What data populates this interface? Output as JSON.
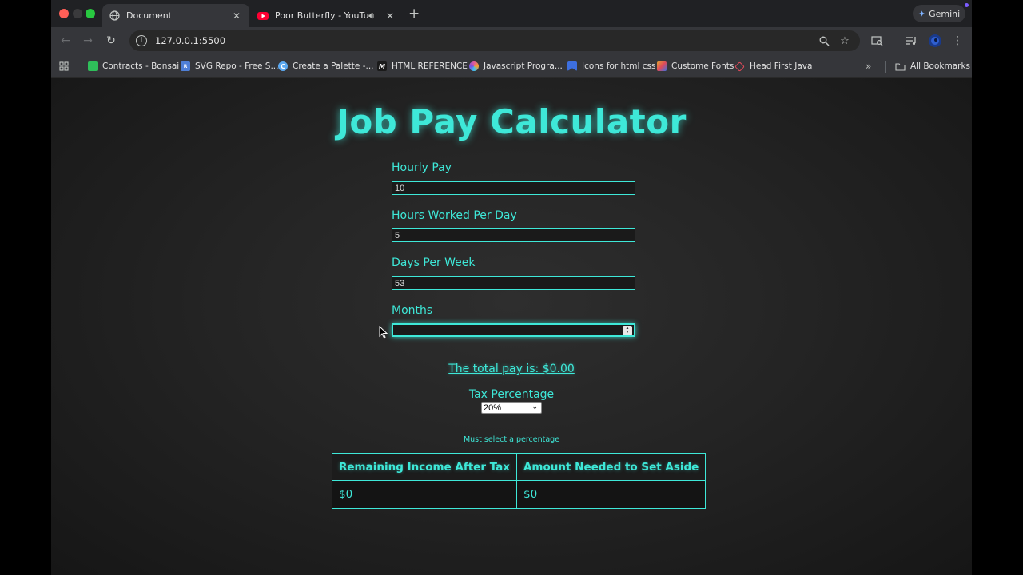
{
  "browser": {
    "tabs": [
      {
        "label": "Document",
        "active": true
      },
      {
        "label": "Poor Butterfly - YouTube",
        "active": false
      }
    ],
    "gemini_label": "Gemini",
    "url": "127.0.0.1:5500",
    "bookmarks": [
      {
        "label": "Contracts - Bonsai",
        "icon": "bonsai-icon",
        "color": "#2fbf5a"
      },
      {
        "label": "SVG Repo - Free S...",
        "icon": "svgrepo-icon",
        "color": "#4f7fd6"
      },
      {
        "label": "Create a Palette -...",
        "icon": "palette-icon",
        "color": "#5ba8f0"
      },
      {
        "label": "HTML REFERENCE",
        "icon": "html-ref-icon",
        "color": "#222222"
      },
      {
        "label": "Javascript Progra...",
        "icon": "javascript-icon",
        "color": "#e05a9a"
      },
      {
        "label": "Icons for html css",
        "icon": "icons-icon",
        "color": "#3d6fe0"
      },
      {
        "label": "Custome Fonts",
        "icon": "fonts-icon",
        "color": "#e0a030"
      },
      {
        "label": "Head First Java",
        "icon": "java-icon",
        "color": "#e04a5a"
      }
    ],
    "all_bookmarks_label": "All Bookmarks"
  },
  "page": {
    "title": "Job Pay Calculator",
    "fields": [
      {
        "label": "Hourly Pay",
        "value": "10"
      },
      {
        "label": "Hours Worked Per Day",
        "value": "5"
      },
      {
        "label": "Days Per Week",
        "value": "53"
      },
      {
        "label": "Months",
        "value": ""
      }
    ],
    "total_text": "The total pay is: $0.00",
    "tax_label": "Tax Percentage",
    "tax_selected": "20%",
    "warning": "Must select a percentage",
    "table": {
      "headers": [
        "Remaining Income After Tax",
        "Amount Needed to Set Aside"
      ],
      "row": [
        "$0",
        "$0"
      ]
    }
  },
  "colors": {
    "accent": "#3ee8d8",
    "background": "#242424"
  }
}
